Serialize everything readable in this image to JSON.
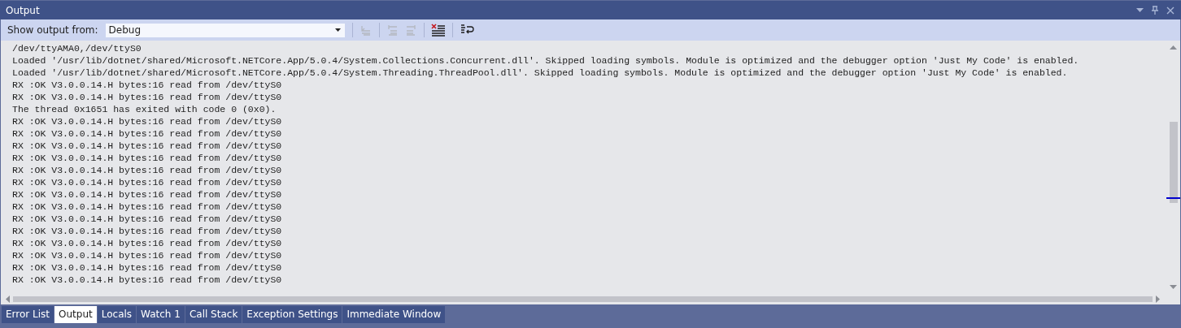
{
  "window": {
    "title": "Output"
  },
  "toolbar": {
    "label": "Show output from:",
    "source": "Debug"
  },
  "output_lines": [
    "/dev/ttyAMA0,/dev/ttyS0",
    "Loaded '/usr/lib/dotnet/shared/Microsoft.NETCore.App/5.0.4/System.Collections.Concurrent.dll'. Skipped loading symbols. Module is optimized and the debugger option 'Just My Code' is enabled.",
    "Loaded '/usr/lib/dotnet/shared/Microsoft.NETCore.App/5.0.4/System.Threading.ThreadPool.dll'. Skipped loading symbols. Module is optimized and the debugger option 'Just My Code' is enabled.",
    "RX :OK V3.0.0.14.H bytes:16 read from /dev/ttyS0",
    "RX :OK V3.0.0.14.H bytes:16 read from /dev/ttyS0",
    "The thread 0x1651 has exited with code 0 (0x0).",
    "RX :OK V3.0.0.14.H bytes:16 read from /dev/ttyS0",
    "RX :OK V3.0.0.14.H bytes:16 read from /dev/ttyS0",
    "RX :OK V3.0.0.14.H bytes:16 read from /dev/ttyS0",
    "RX :OK V3.0.0.14.H bytes:16 read from /dev/ttyS0",
    "RX :OK V3.0.0.14.H bytes:16 read from /dev/ttyS0",
    "RX :OK V3.0.0.14.H bytes:16 read from /dev/ttyS0",
    "RX :OK V3.0.0.14.H bytes:16 read from /dev/ttyS0",
    "RX :OK V3.0.0.14.H bytes:16 read from /dev/ttyS0",
    "RX :OK V3.0.0.14.H bytes:16 read from /dev/ttyS0",
    "RX :OK V3.0.0.14.H bytes:16 read from /dev/ttyS0",
    "RX :OK V3.0.0.14.H bytes:16 read from /dev/ttyS0",
    "RX :OK V3.0.0.14.H bytes:16 read from /dev/ttyS0",
    "RX :OK V3.0.0.14.H bytes:16 read from /dev/ttyS0",
    "RX :OK V3.0.0.14.H bytes:16 read from /dev/ttyS0"
  ],
  "tabs": [
    {
      "label": "Error List",
      "selected": false
    },
    {
      "label": "Output",
      "selected": true
    },
    {
      "label": "Locals",
      "selected": false
    },
    {
      "label": "Watch 1",
      "selected": false
    },
    {
      "label": "Call Stack",
      "selected": false
    },
    {
      "label": "Exception Settings",
      "selected": false
    },
    {
      "label": "Immediate Window",
      "selected": false
    }
  ]
}
